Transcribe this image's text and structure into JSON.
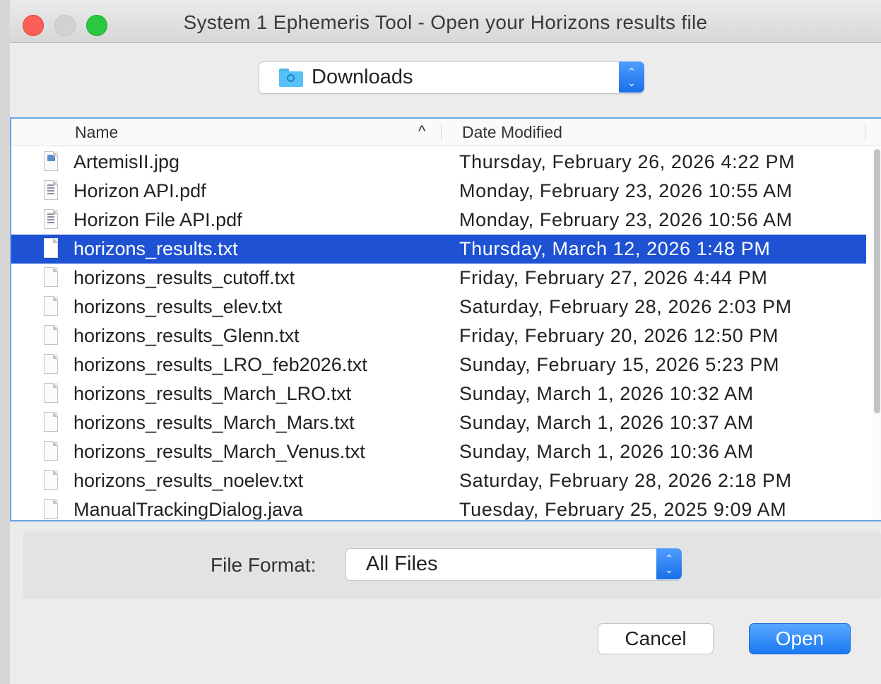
{
  "window": {
    "title": "System 1 Ephemeris Tool - Open your Horizons results file"
  },
  "location": {
    "label": "Downloads",
    "stepper_up": "⌃",
    "stepper_down": "⌄"
  },
  "columns": {
    "name": "Name",
    "sort_indicator": "^",
    "date": "Date Modified"
  },
  "files": [
    {
      "name": "ArtemisII.jpg",
      "date": "Thursday, February 26, 2026 4:22 PM",
      "icon": "image-file-icon"
    },
    {
      "name": "Horizon API.pdf",
      "date": "Monday, February 23, 2026 10:55 AM",
      "icon": "pdf-file-icon"
    },
    {
      "name": "Horizon File API.pdf",
      "date": "Monday, February 23, 2026 10:56 AM",
      "icon": "pdf-file-icon"
    },
    {
      "name": "horizons_results.txt",
      "date": "Thursday, March 12, 2026 1:48 PM",
      "icon": "text-file-icon",
      "selected": true
    },
    {
      "name": "horizons_results_cutoff.txt",
      "date": "Friday, February 27, 2026 4:44 PM",
      "icon": "text-file-icon"
    },
    {
      "name": "horizons_results_elev.txt",
      "date": "Saturday, February 28, 2026 2:03 PM",
      "icon": "text-file-icon"
    },
    {
      "name": "horizons_results_Glenn.txt",
      "date": "Friday, February 20, 2026 12:50 PM",
      "icon": "text-file-icon"
    },
    {
      "name": "horizons_results_LRO_feb2026.txt",
      "date": "Sunday, February 15, 2026 5:23 PM",
      "icon": "text-file-icon"
    },
    {
      "name": "horizons_results_March_LRO.txt",
      "date": "Sunday, March 1, 2026 10:32 AM",
      "icon": "text-file-icon"
    },
    {
      "name": "horizons_results_March_Mars.txt",
      "date": "Sunday, March 1, 2026 10:37 AM",
      "icon": "text-file-icon"
    },
    {
      "name": "horizons_results_March_Venus.txt",
      "date": "Sunday, March 1, 2026 10:36 AM",
      "icon": "text-file-icon"
    },
    {
      "name": "horizons_results_noelev.txt",
      "date": "Saturday, February 28, 2026 2:18 PM",
      "icon": "text-file-icon"
    },
    {
      "name": "ManualTrackingDialog.java",
      "date": "Tuesday, February 25, 2025 9:09 AM",
      "icon": "text-file-icon"
    }
  ],
  "format": {
    "label": "File Format:",
    "value": "All Files",
    "stepper_up": "⌃",
    "stepper_down": "⌄"
  },
  "buttons": {
    "cancel": "Cancel",
    "open": "Open"
  },
  "colors": {
    "selection": "#1f52d3",
    "accent": "#1b78f2",
    "close": "#fc5f57",
    "zoom": "#29c840"
  }
}
